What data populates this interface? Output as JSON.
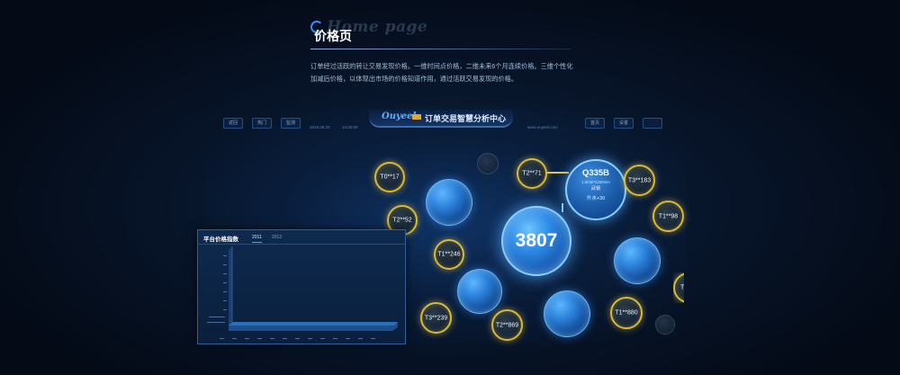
{
  "header": {
    "ghost_title": "Home page",
    "title": "价格页",
    "description": "订单经过活跃的转让交易发现价格。一维时间点价格，二维未来6个月连续价格。三维个性化加减后价格，以体现出市场的价格知道作用，通过活跃交易发现的价格。"
  },
  "dashboard": {
    "brand": "Ouyeel",
    "title": "订单交易智慧分析中心",
    "left_buttons": [
      "返回",
      "热门",
      "监测"
    ],
    "right_buttons": [
      "首页",
      "设置"
    ],
    "date_text": "2016.09.20",
    "time_text": "14:00:00",
    "site_text": "www.ouyeel.com"
  },
  "bubbles": {
    "main_value": "3807",
    "detail": {
      "code": "Q335B",
      "spec": "1.0mm*1250mm",
      "location": "武钢",
      "change": "升水+30"
    },
    "gold_labels": [
      "T0**17",
      "T2**71",
      "T3**183",
      "T2**52",
      "T1**98",
      "T1**246",
      "T3**239",
      "T2**869",
      "T1**880",
      "T"
    ]
  },
  "price_panel": {
    "title": "平台价格指数",
    "tabs": [
      "2011",
      "2012"
    ],
    "active_tab": "2011"
  },
  "colors": {
    "background": "#050c18",
    "accent_blue": "#2f8ef5",
    "gold_ring": "#d9b93b"
  }
}
